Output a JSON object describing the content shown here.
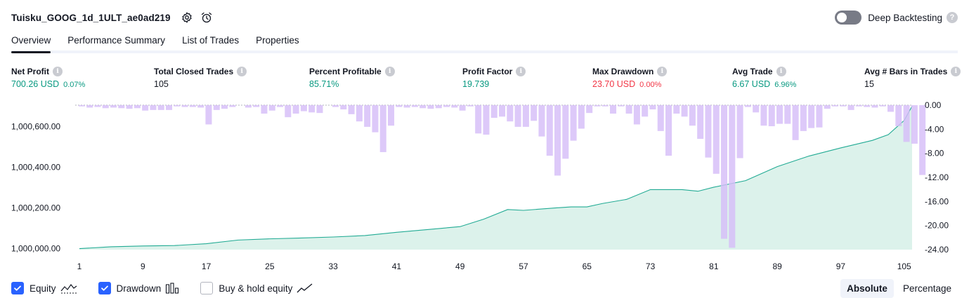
{
  "header": {
    "title": "Tuisku_GOOG_1d_1ULT_ae0ad219"
  },
  "deep_backtesting": {
    "label": "Deep Backtesting",
    "help": "?"
  },
  "tabs": [
    {
      "label": "Overview",
      "active": true
    },
    {
      "label": "Performance Summary",
      "active": false
    },
    {
      "label": "List of Trades",
      "active": false
    },
    {
      "label": "Properties",
      "active": false
    }
  ],
  "stats": {
    "info_glyph": "i",
    "net_profit": {
      "label": "Net Profit",
      "value": "700.26 USD",
      "sub": "0.07%"
    },
    "total_closed_trades": {
      "label": "Total Closed Trades",
      "value": "105"
    },
    "percent_profitable": {
      "label": "Percent Profitable",
      "value": "85.71%"
    },
    "profit_factor": {
      "label": "Profit Factor",
      "value": "19.739"
    },
    "max_drawdown": {
      "label": "Max Drawdown",
      "value": "23.70 USD",
      "sub": "0.00%"
    },
    "avg_trade": {
      "label": "Avg Trade",
      "value": "6.67 USD",
      "sub": "6.96%"
    },
    "avg_bars": {
      "label": "Avg # Bars in Trades",
      "value": "15"
    }
  },
  "colors": {
    "positive": "#089981",
    "negative": "#f23645",
    "equity_line": "#22ab94",
    "equity_fill": "#d6f0e8",
    "drawdown_bar": "#d5bdf8",
    "accent": "#2962ff"
  },
  "chart_data": {
    "type": "area",
    "x_ticks": [
      1,
      9,
      17,
      25,
      33,
      41,
      49,
      57,
      65,
      73,
      81,
      89,
      97,
      105
    ],
    "xlim": [
      1,
      106
    ],
    "equity": {
      "name": "Equity",
      "x": [
        1,
        5,
        9,
        13,
        17,
        21,
        25,
        29,
        33,
        37,
        41,
        45,
        49,
        52,
        55,
        57,
        61,
        63,
        65,
        67,
        70,
        73,
        77,
        79,
        81,
        85,
        89,
        93,
        97,
        101,
        103,
        105,
        106
      ],
      "y": [
        1000000,
        1000009,
        1000013,
        1000015,
        1000024,
        1000042,
        1000048,
        1000052,
        1000057,
        1000064,
        1000080,
        1000094,
        1000108,
        1000145,
        1000192,
        1000188,
        1000200,
        1000205,
        1000205,
        1000222,
        1000242,
        1000290,
        1000290,
        1000282,
        1000302,
        1000334,
        1000403,
        1000455,
        1000495,
        1000532,
        1000560,
        1000630,
        1000700
      ],
      "ylim": [
        999995,
        1000705
      ],
      "y_ticks": [
        "1,000,000.00",
        "1,000,200.00",
        "1,000,400.00",
        "1,000,600.00"
      ],
      "y_tick_values": [
        1000000,
        1000200,
        1000400,
        1000600
      ]
    },
    "drawdown": {
      "name": "Drawdown",
      "ylim": [
        0,
        24
      ],
      "y_ticks": [
        "0.00",
        "-4.00",
        "-8.00",
        "-12.00",
        "-16.00",
        "-20.00",
        "-24.00"
      ],
      "y_tick_values": [
        0,
        4,
        8,
        12,
        16,
        20,
        24
      ],
      "values": [
        0.2,
        0.4,
        0.3,
        0.5,
        0.4,
        0.5,
        0.6,
        0.5,
        0.9,
        0.8,
        0.8,
        0.8,
        0.2,
        0.3,
        0.3,
        0.4,
        3.2,
        0.8,
        0.6,
        0.3,
        0,
        0.4,
        0.3,
        1.4,
        0.9,
        0.3,
        2.0,
        1.4,
        1.0,
        1.2,
        1.3,
        0,
        0.3,
        0.7,
        1.5,
        2.7,
        3.6,
        4.5,
        7.8,
        3.4,
        0.3,
        0.4,
        0.3,
        0.5,
        0.6,
        0.5,
        0.3,
        0.4,
        0.9,
        0.2,
        4.7,
        4.9,
        2.1,
        1.9,
        2.7,
        3.6,
        3.6,
        2.6,
        5.2,
        8.4,
        11.7,
        8.9,
        5.9,
        3.9,
        1.3,
        0.2,
        0.2,
        1.4,
        0.2,
        1.4,
        3.2,
        1.9,
        0.7,
        4.3,
        8.4,
        1.4,
        1.9,
        3.4,
        5.6,
        8.7,
        11.4,
        22.2,
        23.7,
        8.8,
        0.3,
        1.2,
        3.4,
        3.5,
        3.1,
        3.1,
        5.8,
        4.3,
        3.8,
        3.7,
        0.6,
        0.2,
        0.2,
        0.8,
        0.2,
        0.3,
        0.4,
        0.2,
        1.1,
        3.5,
        6.1,
        6.4,
        11.6
      ]
    }
  },
  "footer": {
    "equity": {
      "label": "Equity",
      "checked": true
    },
    "drawdown": {
      "label": "Drawdown",
      "checked": true
    },
    "buy_hold": {
      "label": "Buy & hold equity",
      "checked": false
    },
    "scale": {
      "absolute": "Absolute",
      "percentage": "Percentage",
      "active": "absolute"
    }
  }
}
